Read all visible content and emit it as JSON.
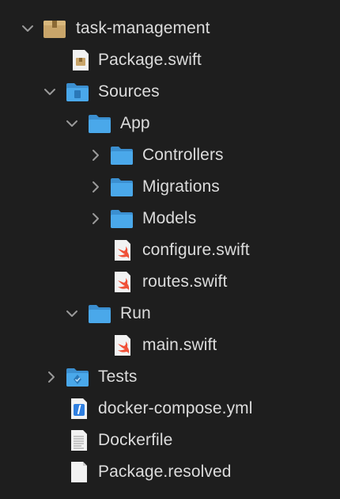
{
  "navigator": {
    "items": [
      {
        "label": "task-management",
        "kind": "package",
        "chevron": "expanded"
      },
      {
        "label": "Package.swift",
        "kind": "package-file",
        "chevron": "none"
      },
      {
        "label": "Sources",
        "kind": "folder-sources",
        "chevron": "expanded"
      },
      {
        "label": "App",
        "kind": "folder",
        "chevron": "expanded"
      },
      {
        "label": "Controllers",
        "kind": "folder",
        "chevron": "collapsed"
      },
      {
        "label": "Migrations",
        "kind": "folder",
        "chevron": "collapsed"
      },
      {
        "label": "Models",
        "kind": "folder",
        "chevron": "collapsed"
      },
      {
        "label": "configure.swift",
        "kind": "swift-file",
        "chevron": "none"
      },
      {
        "label": "routes.swift",
        "kind": "swift-file",
        "chevron": "none"
      },
      {
        "label": "Run",
        "kind": "folder",
        "chevron": "expanded"
      },
      {
        "label": "main.swift",
        "kind": "swift-file",
        "chevron": "none"
      },
      {
        "label": "Tests",
        "kind": "folder-tests",
        "chevron": "collapsed"
      },
      {
        "label": "docker-compose.yml",
        "kind": "yml-file",
        "chevron": "none"
      },
      {
        "label": "Dockerfile",
        "kind": "text-file",
        "chevron": "none"
      },
      {
        "label": "Package.resolved",
        "kind": "blank-file",
        "chevron": "none"
      }
    ]
  },
  "colors": {
    "background": "#1e1e1e",
    "text": "#dcdcdc",
    "folder": "#4aa8ea",
    "swift": "#f05138",
    "chevron": "#9a9a9a"
  },
  "icons": {
    "expanded": "chevron-down-icon",
    "collapsed": "chevron-right-icon",
    "package": "package-box-icon",
    "folder": "folder-icon",
    "swift-file": "swift-file-icon",
    "yml-file": "yml-file-icon",
    "text-file": "text-file-icon",
    "blank-file": "document-icon"
  }
}
